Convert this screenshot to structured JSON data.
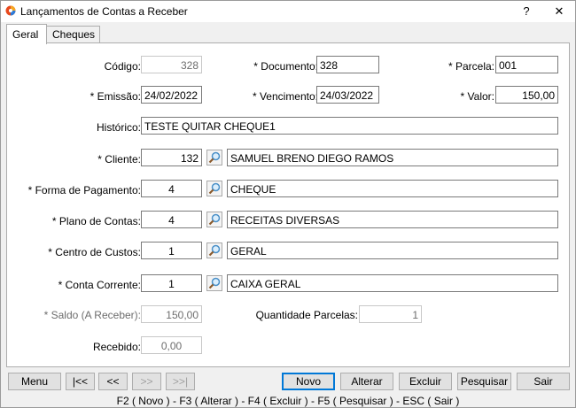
{
  "window": {
    "title": "Lançamentos de Contas a Receber",
    "help_label": "?",
    "close_label": "✕"
  },
  "tabs": [
    {
      "label": "Geral",
      "active": true
    },
    {
      "label": "Cheques",
      "active": false
    }
  ],
  "form": {
    "codigo": {
      "label": "Código:",
      "value": "328"
    },
    "documento": {
      "label": "* Documento:",
      "value": "328"
    },
    "parcela": {
      "label": "* Parcela:",
      "value": "001"
    },
    "emissao": {
      "label": "* Emissão:",
      "value": "24/02/2022"
    },
    "vencimento": {
      "label": "* Vencimento:",
      "value": "24/03/2022"
    },
    "valor": {
      "label": "* Valor:",
      "value": "150,00"
    },
    "historico": {
      "label": "Histórico:",
      "value": "TESTE QUITAR CHEQUE1"
    },
    "cliente": {
      "label": "* Cliente:",
      "code": "132",
      "name": "SAMUEL BRENO DIEGO RAMOS"
    },
    "forma_pagamento": {
      "label": "* Forma de Pagamento:",
      "code": "4",
      "name": "CHEQUE"
    },
    "plano_contas": {
      "label": "* Plano de Contas:",
      "code": "4",
      "name": "RECEITAS DIVERSAS"
    },
    "centro_custos": {
      "label": "* Centro de Custos:",
      "code": "1",
      "name": "GERAL"
    },
    "conta_corrente": {
      "label": "* Conta Corrente:",
      "code": "1",
      "name": "CAIXA GERAL"
    },
    "saldo": {
      "label": "* Saldo (A Receber):",
      "value": "150,00"
    },
    "quantidade_parcelas": {
      "label": "Quantidade Parcelas:",
      "value": "1"
    },
    "recebido": {
      "label": "Recebido:",
      "value": "0,00"
    }
  },
  "buttons": {
    "menu": "Menu",
    "first": "|<<",
    "prev": "<<",
    "next": ">>",
    "last": ">>|",
    "novo": "Novo",
    "alterar": "Alterar",
    "excluir": "Excluir",
    "pesquisar": "Pesquisar",
    "sair": "Sair"
  },
  "shortcuts": "F2 ( Novo )  -  F3 ( Alterar )  -  F4 ( Excluir )  -  F5 ( Pesquisar )  -  ESC ( Sair )",
  "icons": {
    "app": "app-logo-icon",
    "lookup": "magnifier-icon"
  },
  "colors": {
    "focus_accent": "#0078d7",
    "lookup_lens": "#4a90c8"
  }
}
